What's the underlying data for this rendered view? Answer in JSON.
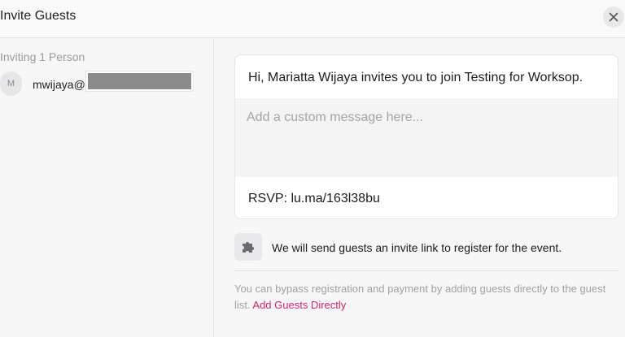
{
  "header": {
    "title": "Invite Guests",
    "close_icon": "close-icon"
  },
  "sidebar": {
    "inviting_label": "Inviting 1 Person",
    "guests": [
      {
        "avatar_initial": "M",
        "email_prefix": "mwijaya@"
      }
    ]
  },
  "invite_card": {
    "greeting": "Hi, Mariatta Wijaya invites you to join Testing for Worksop.",
    "message_placeholder": "Add a custom message here...",
    "rsvp": "RSVP: lu.ma/163l38bu"
  },
  "info": {
    "icon": "puzzle-icon",
    "text": "We will send guests an invite link to register for the event."
  },
  "bypass": {
    "text": "You can bypass registration and payment by adding guests directly to the guest list.",
    "link_label": "Add Guests Directly"
  },
  "colors": {
    "link": "#d6246e",
    "redaction": "#8b8b8b"
  }
}
